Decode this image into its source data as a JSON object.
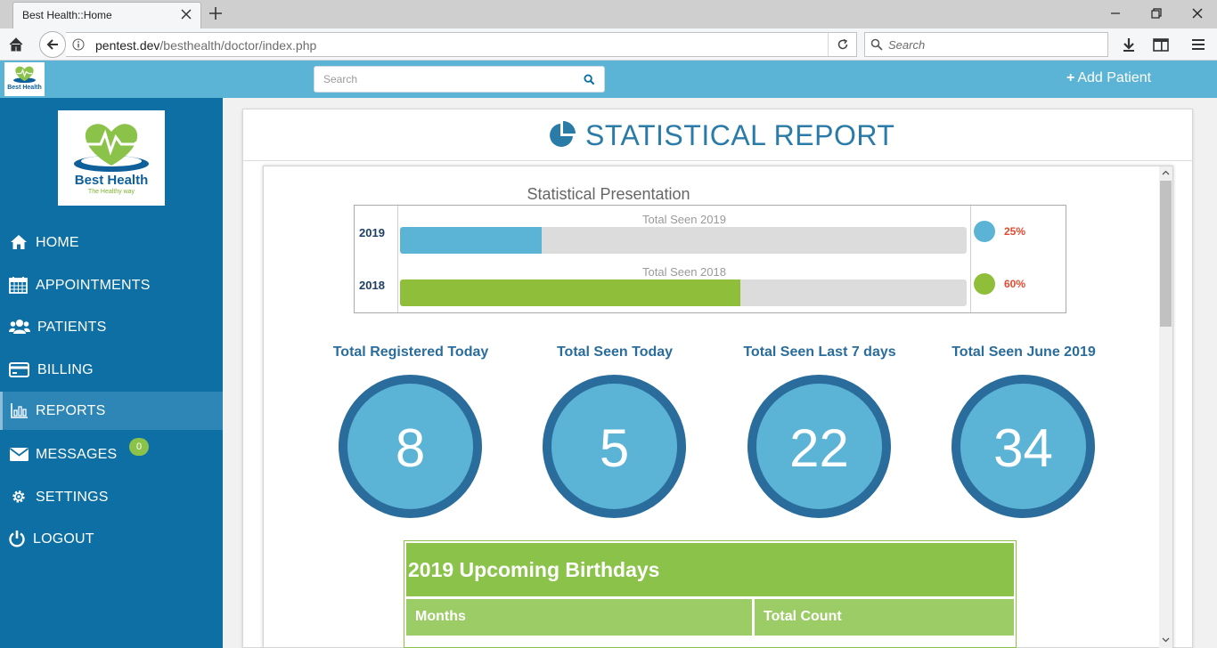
{
  "browser": {
    "tab_title": "Best Health::Home",
    "url_host": "pentest.dev",
    "url_path": "/besthealth/doctor/index.php",
    "search_placeholder": "Search"
  },
  "header": {
    "search_placeholder": "Search",
    "add_patient_icon": "+",
    "add_patient_label": "Add Patient"
  },
  "brand": {
    "name": "Best Health",
    "tagline": "The Healthy way"
  },
  "sidebar": {
    "items": [
      {
        "label": "HOME",
        "icon": "home-icon"
      },
      {
        "label": "APPOINTMENTS",
        "icon": "calendar-icon"
      },
      {
        "label": "PATIENTS",
        "icon": "users-icon"
      },
      {
        "label": "BILLING",
        "icon": "credit-card-icon"
      },
      {
        "label": "REPORTS",
        "icon": "bar-chart-icon",
        "active": true
      },
      {
        "label": "MESSAGES",
        "icon": "envelope-icon",
        "badge": "0"
      },
      {
        "label": "SETTINGS",
        "icon": "gear-icon"
      },
      {
        "label": "LOGOUT",
        "icon": "power-icon"
      }
    ]
  },
  "report": {
    "title": "STATISTICAL REPORT",
    "presentation_title": "Statistical Presentation",
    "progress": [
      {
        "year": "2019",
        "label": "Total Seen 2019",
        "percent": "25%",
        "fraction": 0.25,
        "color": "#5bb3d6"
      },
      {
        "year": "2018",
        "label": "Total Seen 2018",
        "percent": "60%",
        "fraction": 0.6,
        "color": "#8fbe3a"
      }
    ],
    "stats": [
      {
        "label": "Total Registered Today",
        "value": "8"
      },
      {
        "label": "Total Seen Today",
        "value": "5"
      },
      {
        "label": "Total Seen Last 7 days",
        "value": "22"
      },
      {
        "label": "Total Seen June 2019",
        "value": "34"
      }
    ],
    "birthdays": {
      "title": "2019 Upcoming Birthdays",
      "columns": [
        "Months",
        "Total Count"
      ]
    }
  },
  "colors": {
    "sidebar": "#0d6fa3",
    "header": "#5bb3d6",
    "accent_green": "#8bc34a",
    "circle_border": "#2a6d9c"
  }
}
